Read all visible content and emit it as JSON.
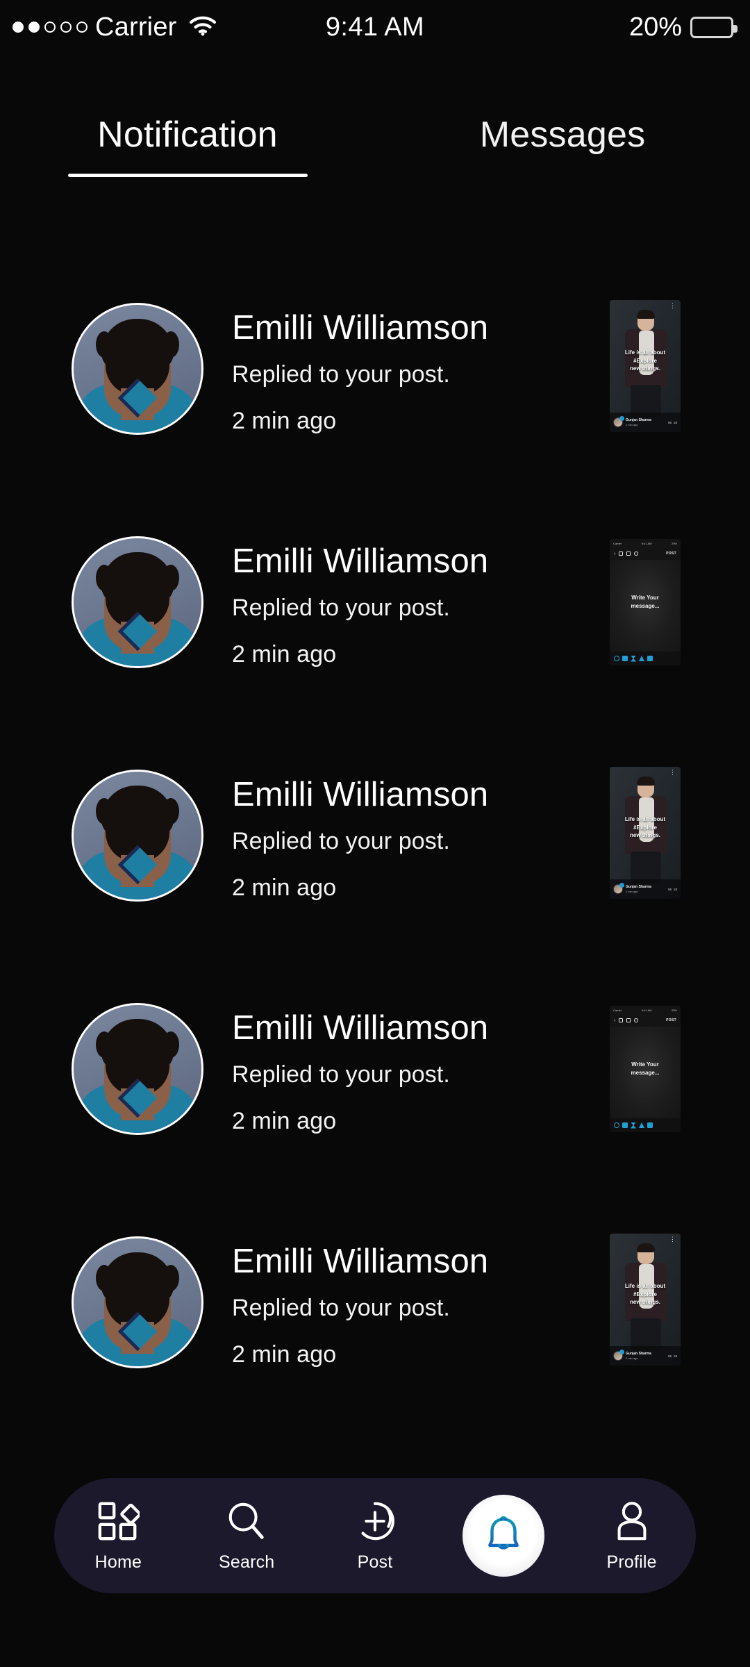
{
  "status_bar": {
    "carrier": "Carrier",
    "signal_dots_filled": 2,
    "signal_dots_total": 5,
    "wifi_icon": "wifi-icon",
    "time": "9:41 AM",
    "battery_percent": "20%",
    "battery_level": 20
  },
  "tabs": [
    {
      "label": "Notification",
      "active": true
    },
    {
      "label": "Messages",
      "active": false
    }
  ],
  "notifications": [
    {
      "name": "Emilli Williamson",
      "action": "Replied to your post.",
      "time": "2 min ago",
      "avatar": "user-avatar",
      "thumbnail_type": "post"
    },
    {
      "name": "Emilli Williamson",
      "action": "Replied to your post.",
      "time": "2 min ago",
      "avatar": "user-avatar",
      "thumbnail_type": "message"
    },
    {
      "name": "Emilli Williamson",
      "action": "Replied to your post.",
      "time": "2 min ago",
      "avatar": "user-avatar",
      "thumbnail_type": "post"
    },
    {
      "name": "Emilli Williamson",
      "action": "Replied to your post.",
      "time": "2 min ago",
      "avatar": "user-avatar",
      "thumbnail_type": "message"
    },
    {
      "name": "Emilli Williamson",
      "action": "Replied to your post.",
      "time": "2 min ago",
      "avatar": "user-avatar",
      "thumbnail_type": "post"
    }
  ],
  "post_thumbnail": {
    "caption_line1": "Life is all about",
    "caption_line2": "#Explore",
    "caption_line3": "new things.",
    "author": "Gunjan Sharma",
    "author_time": "2 min ago",
    "likes": "56",
    "comments": "18",
    "menu_icon": "more-options-icon"
  },
  "message_thumbnail": {
    "carrier": "Carrier",
    "time": "9:41 AM",
    "battery": "20%",
    "post_button": "POST",
    "placeholder_line1": "Write Your",
    "placeholder_line2": "message..."
  },
  "bottom_nav": {
    "items": [
      {
        "label": "Home",
        "icon": "grid-icon",
        "active": false
      },
      {
        "label": "Search",
        "icon": "search-icon",
        "active": false
      },
      {
        "label": "Post",
        "icon": "plus-circle-icon",
        "active": false
      },
      {
        "label": "",
        "icon": "bell-icon",
        "active": true
      },
      {
        "label": "Profile",
        "icon": "person-icon",
        "active": false
      }
    ]
  },
  "colors": {
    "background": "#080808",
    "nav_background": "#1b192b",
    "accent_bell_top": "#0e9bb5",
    "accent_bell_bottom": "#1565c0",
    "text_primary": "#ffffff",
    "avatar_shirt": "#1f7fa3",
    "thumbnail_accent": "#1f9fd6"
  }
}
